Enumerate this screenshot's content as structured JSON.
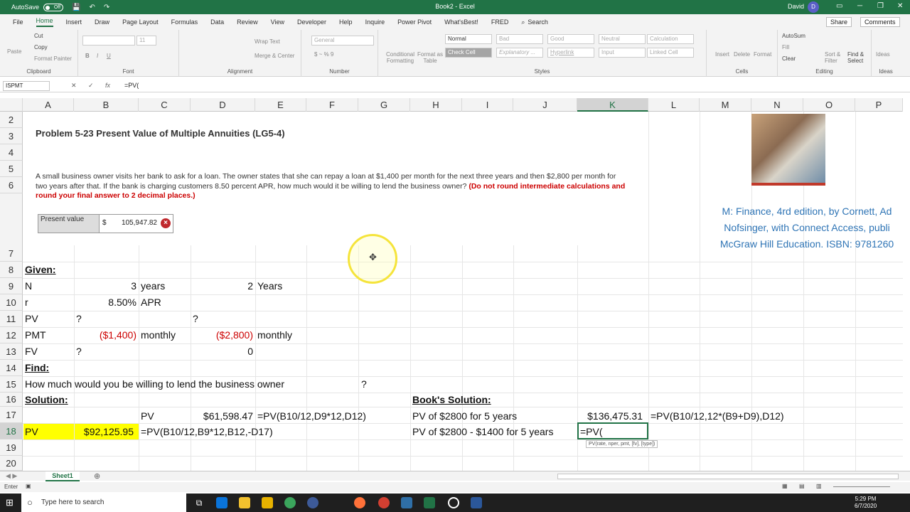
{
  "titlebar": {
    "autosave": "AutoSave",
    "toggle": "Off",
    "doc": "Book2 - Excel",
    "user": "David",
    "avatar": "D"
  },
  "menu": [
    "File",
    "Home",
    "Insert",
    "Draw",
    "Page Layout",
    "Formulas",
    "Data",
    "Review",
    "View",
    "Developer",
    "Help",
    "Inquire",
    "Power Pivot",
    "What'sBest!",
    "FRED",
    "Search"
  ],
  "share": "Share",
  "comments": "Comments",
  "ribbon": {
    "clipboard": "Clipboard",
    "font": "Font",
    "alignment": "Alignment",
    "number": "Number",
    "styles": "Styles",
    "cells": "Cells",
    "editing": "Editing",
    "ideas": "Ideas",
    "cut": "Cut",
    "copy": "Copy",
    "painter": "Format Painter",
    "paste": "Paste",
    "fontsize": "11",
    "wrap": "Wrap Text",
    "merge": "Merge & Center",
    "general": "General",
    "cond": "Conditional Formatting",
    "fmt": "Format as Table",
    "normal": "Normal",
    "bad": "Bad",
    "good": "Good",
    "neutral": "Neutral",
    "calculation": "Calculation",
    "checkcell": "Check Cell",
    "explanatory": "Explanatory ...",
    "hyperlink": "Hyperlink",
    "input": "Input",
    "linked": "Linked Cell",
    "insert": "Insert",
    "delete": "Delete",
    "format": "Format",
    "autosum": "AutoSum",
    "fill": "Fill",
    "clear": "Clear",
    "sort": "Sort & Filter",
    "find": "Find & Select",
    "ideasbtn": "Ideas"
  },
  "formula": {
    "name": "ISPMT",
    "content": "=PV("
  },
  "columns": [
    "A",
    "B",
    "C",
    "D",
    "E",
    "F",
    "G",
    "H",
    "I",
    "J",
    "K",
    "L",
    "M",
    "N",
    "O",
    "P"
  ],
  "rows": [
    "2",
    "3",
    "4",
    "5",
    "6",
    "7",
    "8",
    "9",
    "10",
    "11",
    "12",
    "13",
    "14",
    "15",
    "16",
    "17",
    "18",
    "19",
    "20"
  ],
  "problem": {
    "title": "Problem 5-23 Present Value of Multiple Annuities (LG5-4)",
    "text": "A small business owner visits her bank to ask for a loan. The owner states that she can repay a loan at $1,400 per month for the next three years and then $2,800 per month for two years after that. If the bank is charging customers 8.50 percent APR, how much would it be willing to lend the business owner?",
    "note": "(Do not round intermediate calculations and round your final answer to 2 decimal places.)",
    "pv_label": "Present value",
    "pv_dollar": "$",
    "pv_value": "105,947.82",
    "x": "×"
  },
  "citation": [
    "M: Finance, 4rd edition, by Cornett, Ad",
    "Nofsinger, with Connect Access, publi",
    "McGraw Hill Education. ISBN: 9781260"
  ],
  "cells": {
    "a8": "Given:",
    "a9": "N",
    "b9": "3",
    "c9": "years",
    "d9": "2",
    "e9": "Years",
    "a10": "r",
    "b10": "8.50%",
    "c10": "APR",
    "a11": "PV",
    "b11": "?",
    "d11": "?",
    "a12": "PMT",
    "b12": "($1,400)",
    "c12": "monthly",
    "d12": "($2,800)",
    "e12": "monthly",
    "a13": "FV",
    "b13": "?",
    "d13": "0",
    "a14": "Find:",
    "a15": "How much would you be willing to lend the business owner",
    "g15": "?",
    "a16": "Solution:",
    "h16": "Book's Solution:",
    "c17": "PV",
    "d17": "$61,598.47",
    "e17": "=PV(B10/12,D9*12,D12)",
    "h17": "PV of $2800 for 5 years",
    "k17": "$136,475.31",
    "l17": "=PV(B10/12,12*(B9+D9),D12)",
    "a18": "PV",
    "b18": "$92,125.95",
    "c18": "=PV(B10/12,B9*12,B12,-D17)",
    "h18": "PV of $2800 - $1400 for 5 years",
    "k18": "=PV("
  },
  "tooltip": "PV(rate, nper, pmt, [fv], [type])",
  "sheet": "Sheet1",
  "status": "Enter",
  "taskbar": {
    "search": "Type here to search",
    "time": "5:29 PM",
    "date": "6/7/2020"
  },
  "colors": {
    "excel_green": "#217346",
    "highlight": "#ffff00",
    "negative": "#cc0000"
  }
}
